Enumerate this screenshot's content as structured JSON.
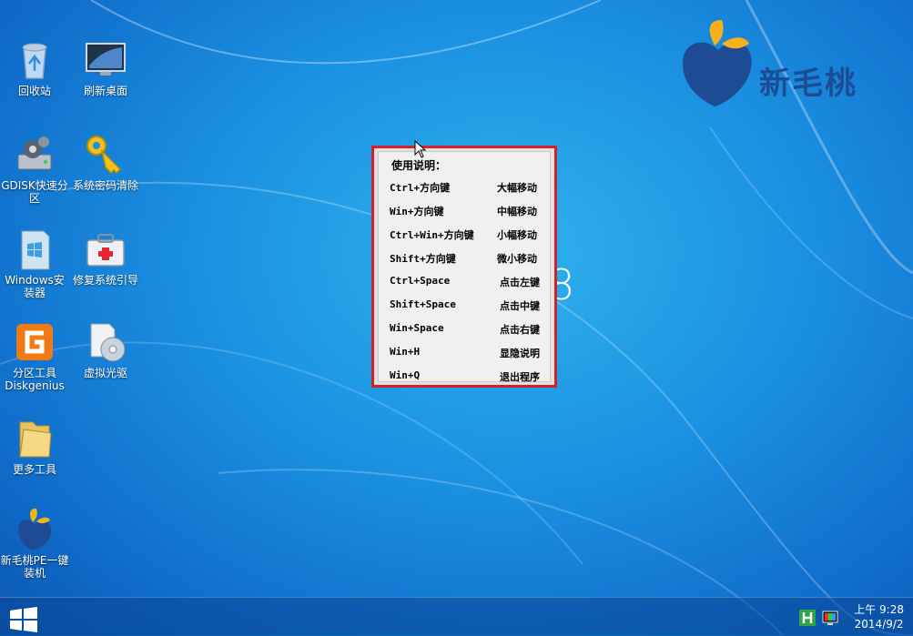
{
  "desktop": {
    "icons": [
      {
        "label": "回收站"
      },
      {
        "label": "刷新桌面"
      },
      {
        "label": "GDISK快速分区"
      },
      {
        "label": "系统密码清除"
      },
      {
        "label": "Windows安装器"
      },
      {
        "label": "修复系统引导"
      },
      {
        "label": "分区工具Diskgenius"
      },
      {
        "label": "虚拟光驱"
      },
      {
        "label": "更多工具"
      },
      {
        "label": "新毛桃PE一键装机"
      }
    ],
    "wallpaper_text": "8",
    "brand": "新毛桃"
  },
  "help_dialog": {
    "title": "使用说明：",
    "rows": [
      {
        "key": "Ctrl+方向键",
        "action": "大幅移动"
      },
      {
        "key": "Win+方向键",
        "action": "中幅移动"
      },
      {
        "key": "Ctrl+Win+方向键",
        "action": "小幅移动"
      },
      {
        "key": "Shift+方向键",
        "action": "微小移动"
      },
      {
        "key": "Ctrl+Space",
        "action": "点击左键"
      },
      {
        "key": "Shift+Space",
        "action": "点击中键"
      },
      {
        "key": "Win+Space",
        "action": "点击右键"
      },
      {
        "key": "Win+H",
        "action": "显隐说明"
      },
      {
        "key": "Win+Q",
        "action": "退出程序"
      }
    ],
    "border_color": "#d4202a"
  },
  "taskbar": {
    "clock_time": "上午 9:28",
    "clock_date": "2014/9/2",
    "tray_icons": [
      "h-tray-icon",
      "display-tray-icon"
    ]
  },
  "colors": {
    "wallpaper": "#1a8fe0",
    "brand": "#1d4c95",
    "leaf": "#f7b21a"
  }
}
